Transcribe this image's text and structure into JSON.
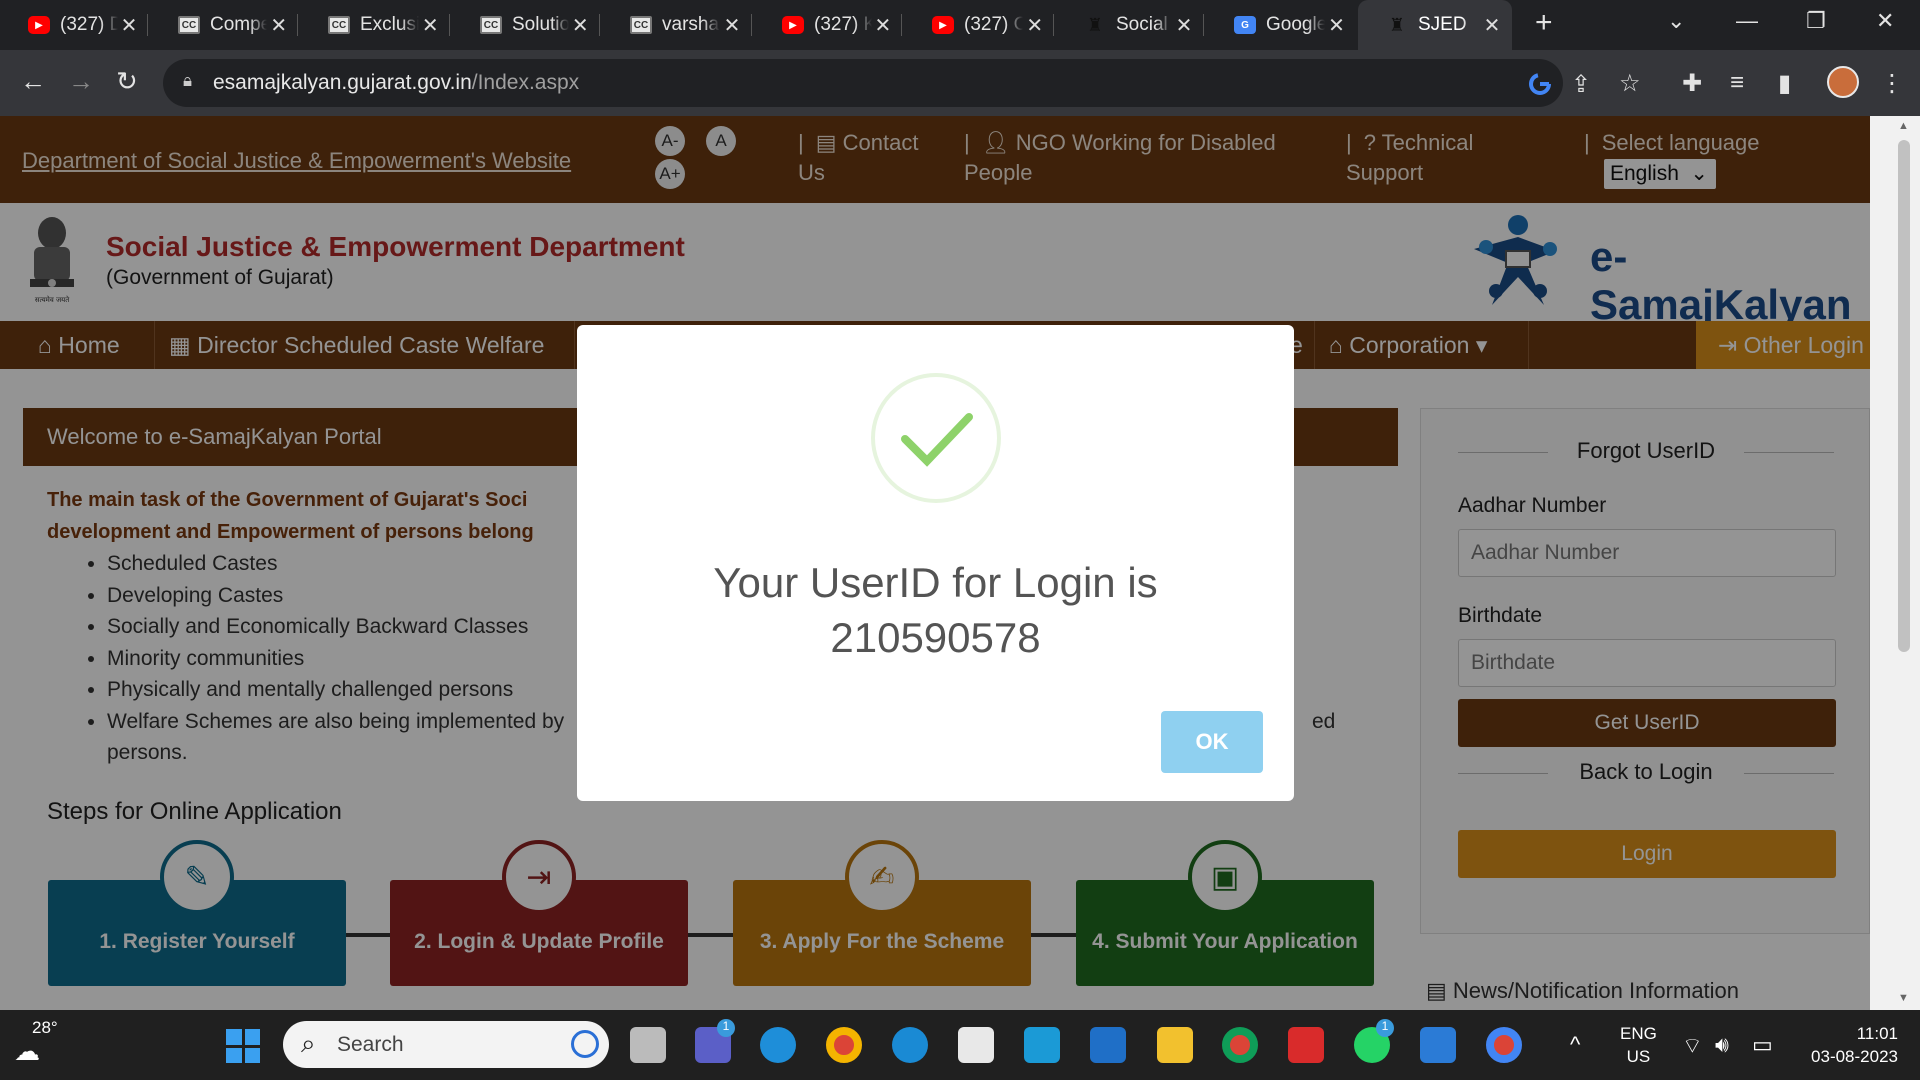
{
  "browser": {
    "tabs": [
      {
        "title": "(327) D",
        "icon": "youtube-icon"
      },
      {
        "title": "Compe",
        "icon": "cc-icon"
      },
      {
        "title": "Exclusi",
        "icon": "cc-icon"
      },
      {
        "title": "Solutio",
        "icon": "cc-icon"
      },
      {
        "title": "varsha",
        "icon": "cc-icon"
      },
      {
        "title": "(327) K",
        "icon": "youtube-icon"
      },
      {
        "title": "(327) C",
        "icon": "youtube-icon"
      },
      {
        "title": "Social",
        "icon": "emblem-icon"
      },
      {
        "title": "Google",
        "icon": "google-translate-icon"
      },
      {
        "title": "SJED",
        "icon": "emblem-icon",
        "active": true
      }
    ],
    "url_domain": "esamajkalyan.gujarat.gov.in",
    "url_path": "/Index.aspx"
  },
  "topbar": {
    "dept_link": "Department of Social Justice & Empowerment's Website",
    "font_minus": "A-",
    "font_normal": "A",
    "font_plus": "A+",
    "contact": "Contact Us",
    "ngo": "NGO Working for Disabled People",
    "support": "Technical Support",
    "select_language": "Select language",
    "language_value": "English"
  },
  "header": {
    "title": "Social Justice & Empowerment Department",
    "subtitle": "(Government of Gujarat)",
    "brand": "e-SamajKalyan",
    "emblem_caption": "सत्यमेव जयते"
  },
  "nav": {
    "home": "Home",
    "director": "Director Scheduled Caste Welfare",
    "partial": "e",
    "corporation": "Corporation",
    "other_login": "Other Login"
  },
  "welcome": {
    "heading": "Welcome to e-SamajKalyan Portal",
    "intro_line1": "The main task of the Government of Gujarat's Soci",
    "intro_line2": "development and Empowerment of persons belong",
    "bullets": [
      "Scheduled Castes",
      "Developing Castes",
      "Socially and Economically Backward Classes",
      "Minority communities",
      "Physically and mentally challenged persons",
      "Welfare Schemes are also being implemented by"
    ],
    "bullet_tail_right": "ed",
    "bullet_tail_next": "persons.",
    "steps_title": "Steps for Online Application",
    "steps": [
      {
        "label": "1. Register Yourself",
        "color": "#0e6b8c",
        "icon": "pencil-icon"
      },
      {
        "label": "2. Login & Update Profile",
        "color": "#8e2424",
        "icon": "sign-in-icon"
      },
      {
        "label": "3. Apply For the Scheme",
        "color": "#b8760f",
        "icon": "edit-icon"
      },
      {
        "label": "4. Submit Your Application",
        "color": "#1f6b1f",
        "icon": "save-icon"
      }
    ]
  },
  "sidebar": {
    "forgot_heading": "Forgot UserID",
    "aadhar_label": "Aadhar Number",
    "aadhar_placeholder": "Aadhar Number",
    "birthdate_label": "Birthdate",
    "birthdate_placeholder": "Birthdate",
    "get_userid": "Get UserID",
    "back_heading": "Back to Login",
    "login": "Login",
    "news": "News/Notification Information"
  },
  "modal": {
    "message_line1": "Your UserID for Login is",
    "userid": "210590578",
    "ok": "OK"
  },
  "taskbar": {
    "temperature": "28°",
    "search": "Search",
    "lang_top": "ENG",
    "lang_bottom": "US",
    "time": "11:01",
    "date": "03-08-2023",
    "badge_teams": "1",
    "badge_whatsapp": "1"
  },
  "colors": {
    "brown": "#6b3a12",
    "orange": "#d9901a",
    "ok_button": "#8fd0f0",
    "check": "#8ed26a"
  }
}
